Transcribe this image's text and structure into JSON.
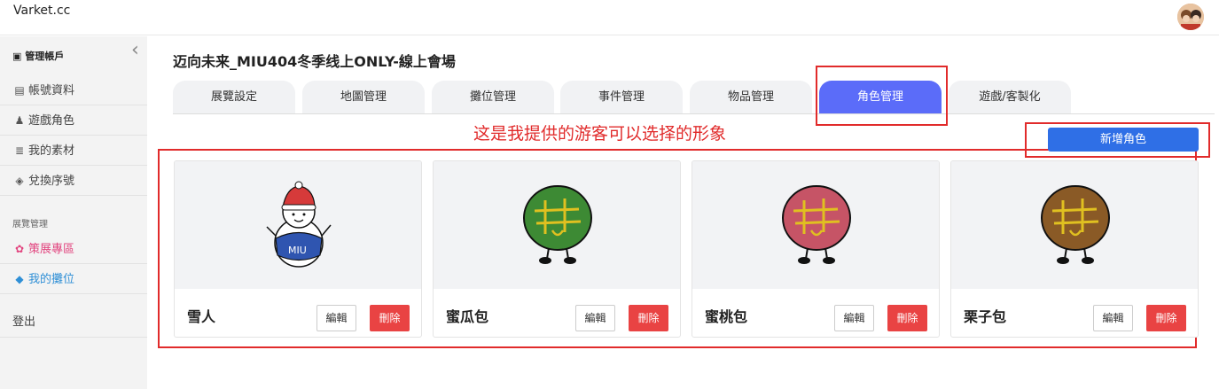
{
  "header": {
    "brand": "Varket.cc"
  },
  "sidebar": {
    "heading": "管理帳戶",
    "items": [
      {
        "label": "帳號資料",
        "icon": "id-card-icon"
      },
      {
        "label": "遊戲角色",
        "icon": "person-icon"
      },
      {
        "label": "我的素材",
        "icon": "database-icon"
      },
      {
        "label": "兌換序號",
        "icon": "ticket-icon"
      }
    ],
    "section": "展覽管理",
    "section_items": [
      {
        "label": "策展專區",
        "icon": "cubes-icon",
        "color": "#e2457f"
      },
      {
        "label": "我的攤位",
        "icon": "cube-icon",
        "color": "#2f8fd6"
      }
    ],
    "logout": "登出"
  },
  "main": {
    "title": "迈向未来_MIU404冬季线上ONLY-線上會場",
    "tabs": [
      "展覽設定",
      "地圖管理",
      "攤位管理",
      "事件管理",
      "物品管理",
      "角色管理",
      "遊戲/客製化"
    ],
    "active_tab": "角色管理",
    "annotation": "这是我提供的游客可以选择的形象",
    "add_button": "新增角色",
    "edit_label": "編輯",
    "delete_label": "刪除",
    "characters": [
      {
        "name": "雪人"
      },
      {
        "name": "蜜瓜包",
        "body_color": "#3d8a34"
      },
      {
        "name": "蜜桃包",
        "body_color": "#c65466"
      },
      {
        "name": "栗子包",
        "body_color": "#8a5a26"
      }
    ],
    "colors": {
      "accent": "#5b6cf9",
      "primary_button": "#2f6fe6",
      "danger": "#e94343",
      "annotation": "#e12b2b"
    }
  }
}
